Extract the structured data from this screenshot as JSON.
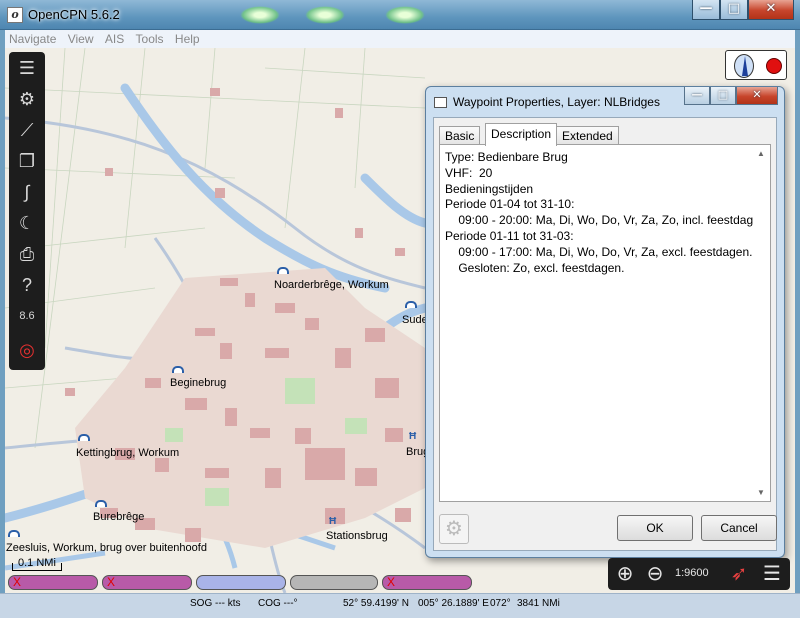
{
  "app": {
    "title": "OpenCPN 5.6.2"
  },
  "menu": [
    "Navigate",
    "View",
    "AIS",
    "Tools",
    "Help"
  ],
  "map_labels": [
    {
      "text": "Noarderbrêge, Workum"
    },
    {
      "text": "Sude"
    },
    {
      "text": "Beginebrug"
    },
    {
      "text": "Kettingbrug, Workum"
    },
    {
      "text": "Brug"
    },
    {
      "text": "Burebrêge"
    },
    {
      "text": "Stationsbrug"
    },
    {
      "text": "Zeesluis, Workum, brug over buitenhoofd"
    }
  ],
  "toolbar_icons": [
    "menu-icon",
    "settings-gear-icon",
    "route-icon",
    "documents-icon",
    "track-icon",
    "night-mode-icon",
    "print-icon",
    "help-icon",
    "tide-icon",
    "mob-lifebuoy-icon"
  ],
  "toolbar_tide_text": "8.6",
  "dialog": {
    "title": "Waypoint Properties, Layer: NLBridges",
    "tabs": [
      "Basic",
      "Description",
      "Extended"
    ],
    "active_tab": "Description",
    "description": "Type: Bedienbare Brug\nVHF:  20\nBedieningstijden\nPeriode 01-04 tot 31-10:\n    09:00 - 20:00: Ma, Di, Wo, Do, Vr, Za, Zo, incl. feestdagen.\nPeriode 01-11 tot 31-03:\n    09:00 - 17:00: Ma, Di, Wo, Do, Vr, Za, excl. feestdagen.\n    Gesloten: Zo, excl. feestdagen.",
    "ok_label": "OK",
    "cancel_label": "Cancel"
  },
  "scale": {
    "label": "0.1 NMi"
  },
  "zoom": {
    "label": "1:9600"
  },
  "status": {
    "sog": "SOG --- kts",
    "cog": "COG ---°",
    "lat": "52° 59.4199' N",
    "lon": "005° 26.1889' E",
    "bearing": "072°",
    "distance": "3841 NMi"
  },
  "colors": {
    "water": "#a9c8e8",
    "land": "#f1eee6",
    "buildings": "#d9a9a9",
    "accent_red": "#e01010"
  }
}
